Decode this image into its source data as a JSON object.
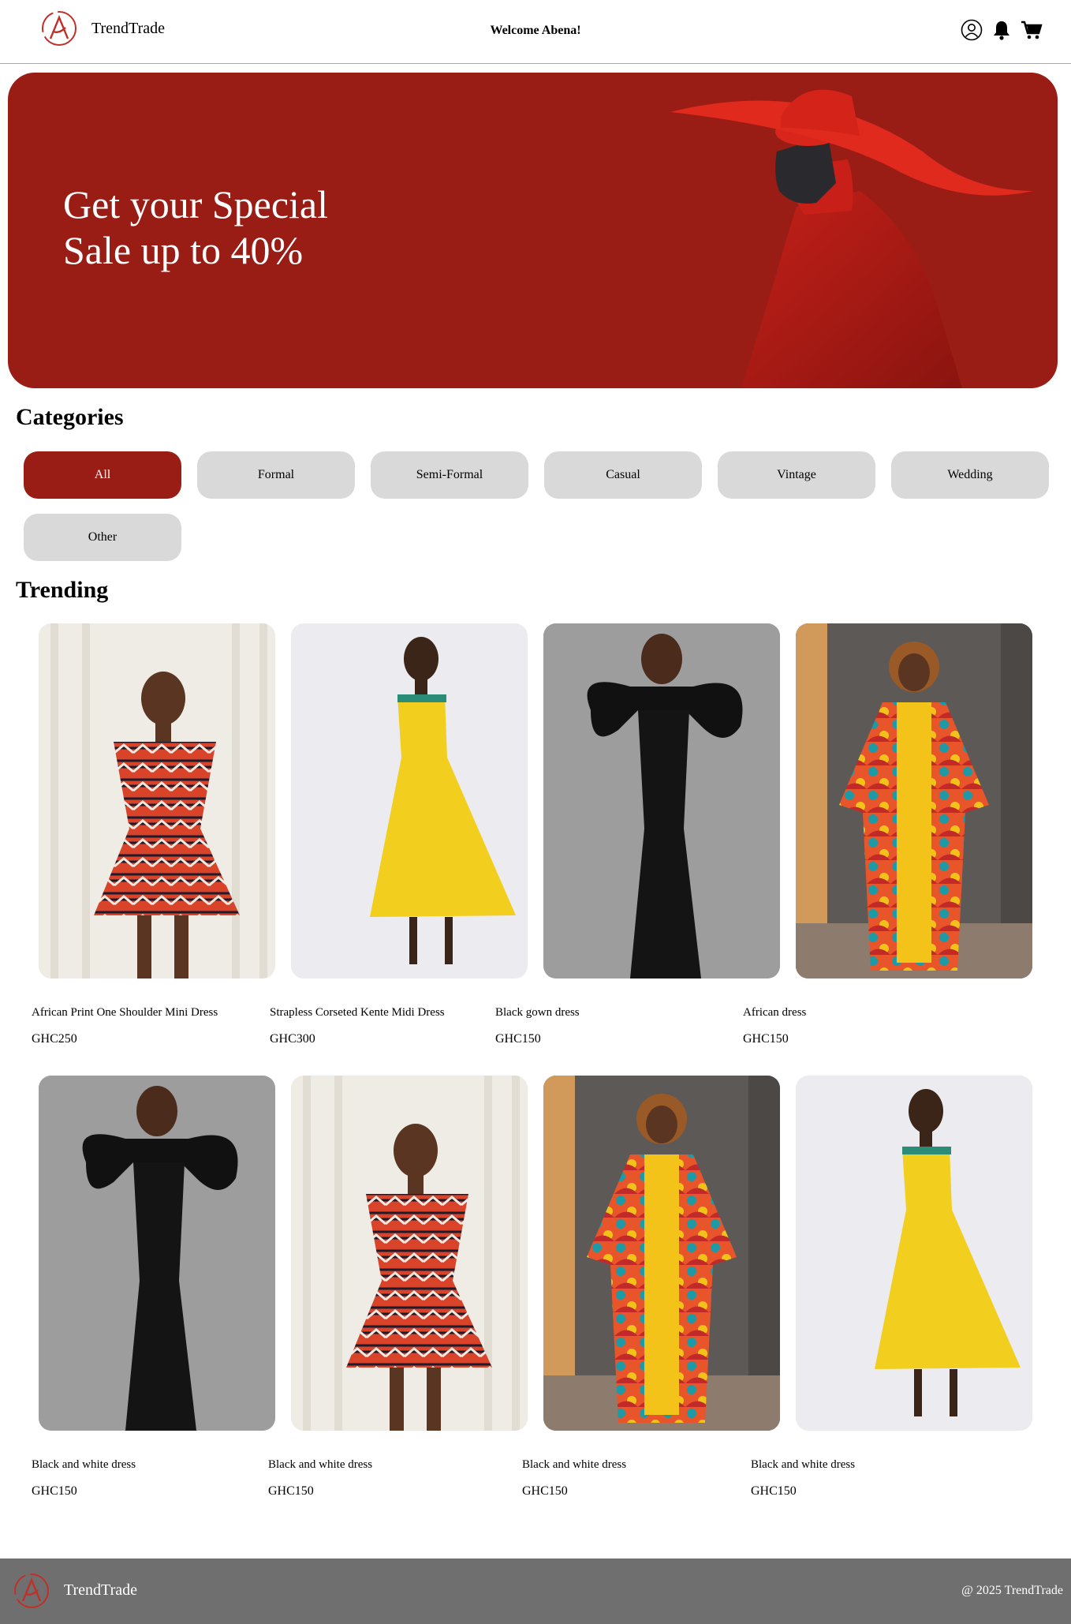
{
  "header": {
    "brand": "TrendTrade",
    "welcome": "Welcome Abena!",
    "icons": [
      "user-icon",
      "bell-icon",
      "cart-icon"
    ]
  },
  "hero": {
    "line1": "Get your Special",
    "line2": "Sale up to 40%"
  },
  "categories": {
    "title": "Categories",
    "items": [
      {
        "label": "All",
        "active": true
      },
      {
        "label": "Formal",
        "active": false
      },
      {
        "label": "Semi-Formal",
        "active": false
      },
      {
        "label": "Casual",
        "active": false
      },
      {
        "label": "Vintage",
        "active": false
      },
      {
        "label": "Wedding",
        "active": false
      },
      {
        "label": "Other",
        "active": false
      }
    ]
  },
  "trending": {
    "title": "Trending",
    "products": [
      {
        "name": "African Print One Shoulder Mini Dress",
        "price": "GHC250",
        "image": "print-mini-dress"
      },
      {
        "name": "Strapless Corseted Kente Midi Dress",
        "price": "GHC300",
        "image": "yellow-midi-dress"
      },
      {
        "name": "Black gown dress",
        "price": "GHC150",
        "image": "black-gown"
      },
      {
        "name": "African dress",
        "price": "GHC150",
        "image": "print-kimono-jumpsuit"
      },
      {
        "name": "Black and white dress",
        "price": "GHC150",
        "image": "black-gown"
      },
      {
        "name": "Black and white dress",
        "price": "GHC150",
        "image": "print-mini-dress"
      },
      {
        "name": "Black and white dress",
        "price": "GHC150",
        "image": "print-kimono-jumpsuit"
      },
      {
        "name": "Black and white dress",
        "price": "GHC150",
        "image": "yellow-midi-dress"
      }
    ]
  },
  "footer": {
    "brand": "TrendTrade",
    "copyright": "@ 2025 TrendTrade"
  },
  "colors": {
    "accent": "#991c15",
    "chip": "#d9d9d9",
    "footer": "#6f6f6f"
  }
}
